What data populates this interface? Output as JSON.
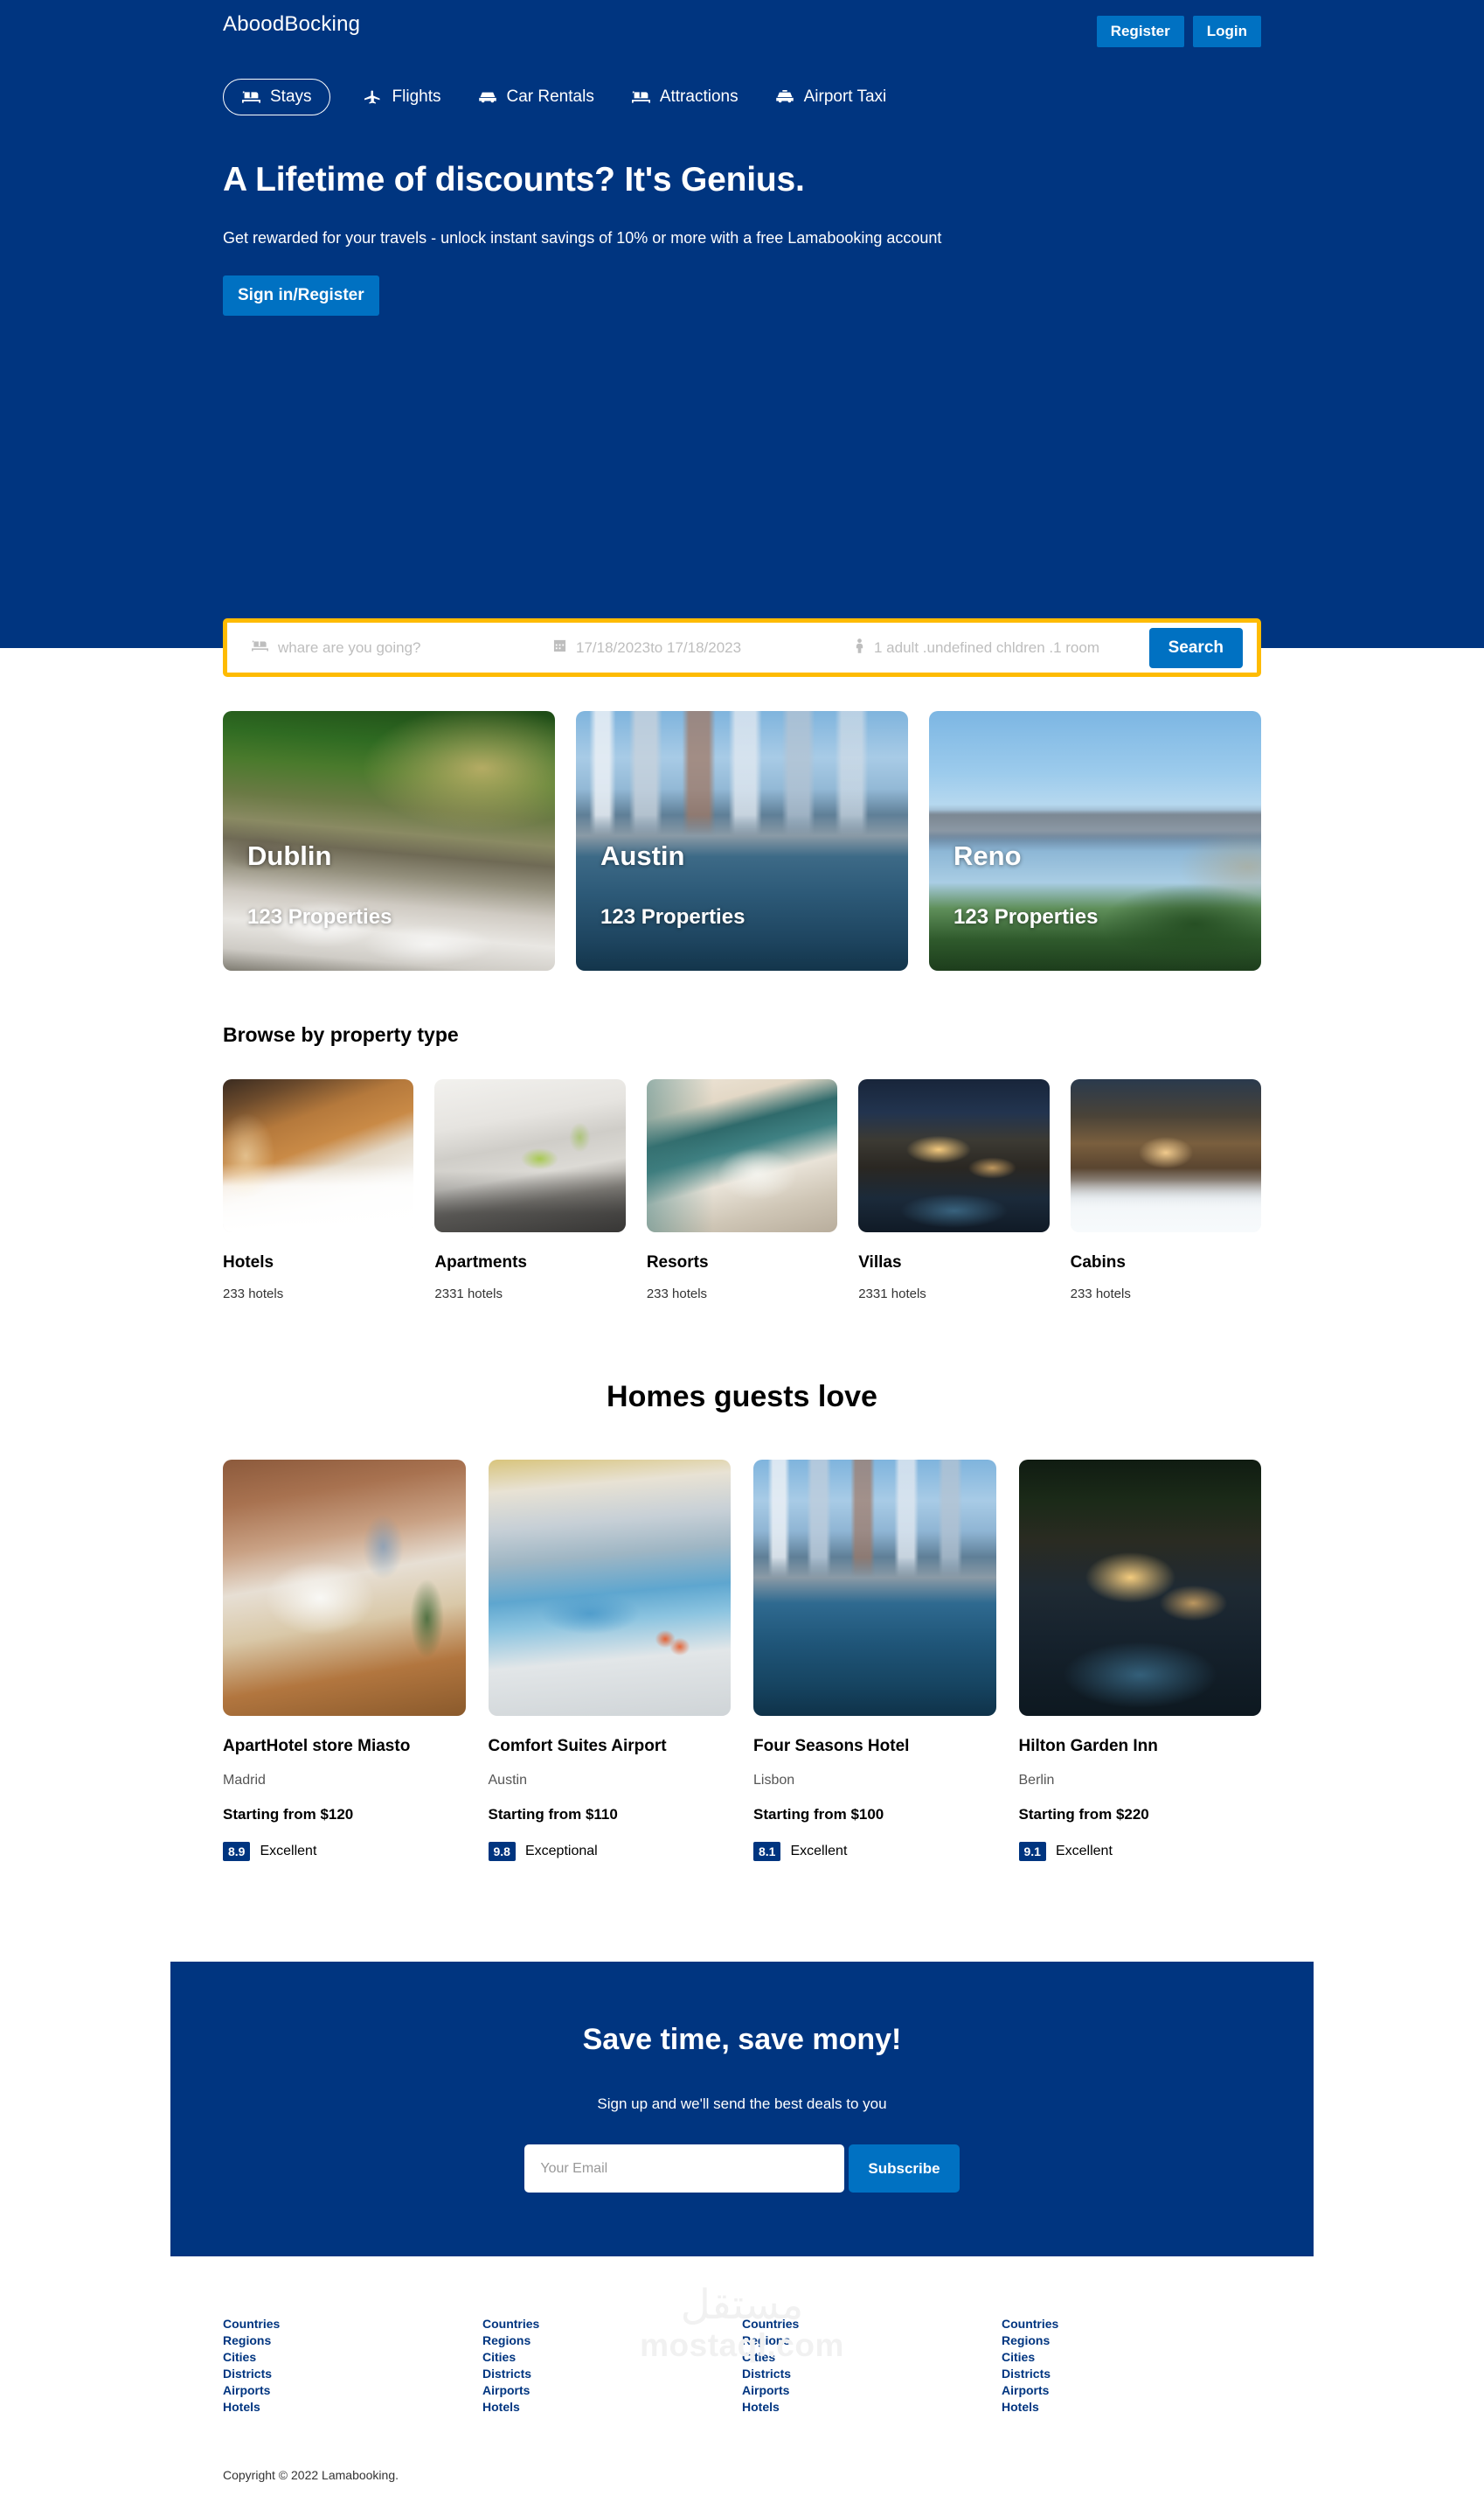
{
  "colors": {
    "brand_dark_blue": "#003580",
    "brand_bright_blue": "#0071c2",
    "accent_yellow": "#febb02"
  },
  "header": {
    "logo": "AboodBocking",
    "register_label": "Register",
    "login_label": "Login",
    "nav": [
      {
        "label": "Stays",
        "icon": "bed-icon",
        "active": true
      },
      {
        "label": "Flights",
        "icon": "plane-icon",
        "active": false
      },
      {
        "label": "Car Rentals",
        "icon": "car-icon",
        "active": false
      },
      {
        "label": "Attractions",
        "icon": "bed-icon",
        "active": false
      },
      {
        "label": "Airport Taxi",
        "icon": "taxi-icon",
        "active": false
      }
    ]
  },
  "hero": {
    "title": "A Lifetime of discounts? It's Genius.",
    "description": "Get rewarded for your travels - unlock instant savings of 10% or more with a free Lamabooking account",
    "cta_label": "Sign in/Register"
  },
  "search": {
    "destination_placeholder": "whare are you going?",
    "destination_icon": "bed-icon",
    "date_icon": "calendar-icon",
    "date_value": "17/18/2023to 17/18/2023",
    "options_icon": "person-icon",
    "options_value": "1 adult .undefined chldren .1 room",
    "search_button": "Search"
  },
  "featured": [
    {
      "name": "Dublin",
      "properties": "123 Properties",
      "photo": "forest-waterfall-photo"
    },
    {
      "name": "Austin",
      "properties": "123 Properties",
      "photo": "city-skyline-photo"
    },
    {
      "name": "Reno",
      "properties": "123 Properties",
      "photo": "lake-mountains-photo"
    }
  ],
  "property_types": {
    "title": "Browse by property type",
    "items": [
      {
        "name": "Hotels",
        "count": "233 hotels",
        "photo": "hotel-bedroom-photo"
      },
      {
        "name": "Apartments",
        "count": "2331 hotels",
        "photo": "apartment-kitchen-photo"
      },
      {
        "name": "Resorts",
        "count": "233 hotels",
        "photo": "resort-room-photo"
      },
      {
        "name": "Villas",
        "count": "2331 hotels",
        "photo": "villa-night-photo"
      },
      {
        "name": "Cabins",
        "count": "233 hotels",
        "photo": "cabin-snow-photo"
      }
    ]
  },
  "homes": {
    "title": "Homes guests love",
    "items": [
      {
        "name": "ApartHotel store Miasto",
        "city": "Madrid",
        "price": "Starting from $120",
        "rating": "8.9",
        "rating_text": "Excellent",
        "photo": "brick-bedroom-photo"
      },
      {
        "name": "Comfort Suites Airport",
        "city": "Austin",
        "price": "Starting from $110",
        "rating": "9.8",
        "rating_text": "Exceptional",
        "photo": "hotel-pool-photo"
      },
      {
        "name": "Four Seasons Hotel",
        "city": "Lisbon",
        "price": "Starting from $100",
        "rating": "8.1",
        "rating_text": "Excellent",
        "photo": "city-skyline-photo"
      },
      {
        "name": "Hilton Garden Inn",
        "city": "Berlin",
        "price": "Starting from $220",
        "rating": "9.1",
        "rating_text": "Excellent",
        "photo": "modern-villa-photo"
      }
    ]
  },
  "newsletter": {
    "title": "Save time, save mony!",
    "description": "Sign up and we'll send the best deals to you",
    "email_placeholder": "Your Email",
    "subscribe_label": "Subscribe"
  },
  "footer": {
    "columns": [
      {
        "links": [
          "Countries",
          "Regions",
          "Cities",
          "Districts",
          "Airports",
          "Hotels"
        ]
      },
      {
        "links": [
          "Countries",
          "Regions",
          "Cities",
          "Districts",
          "Airports",
          "Hotels"
        ]
      },
      {
        "links": [
          "Countries",
          "Regions",
          "Cities",
          "Districts",
          "Airports",
          "Hotels"
        ]
      },
      {
        "links": [
          "Countries",
          "Regions",
          "Cities",
          "Districts",
          "Airports",
          "Hotels"
        ]
      }
    ],
    "copyright": "Copyright © 2022 Lamabooking."
  },
  "watermark": {
    "arabic": "مستقل",
    "latin": "mostaql.com"
  }
}
